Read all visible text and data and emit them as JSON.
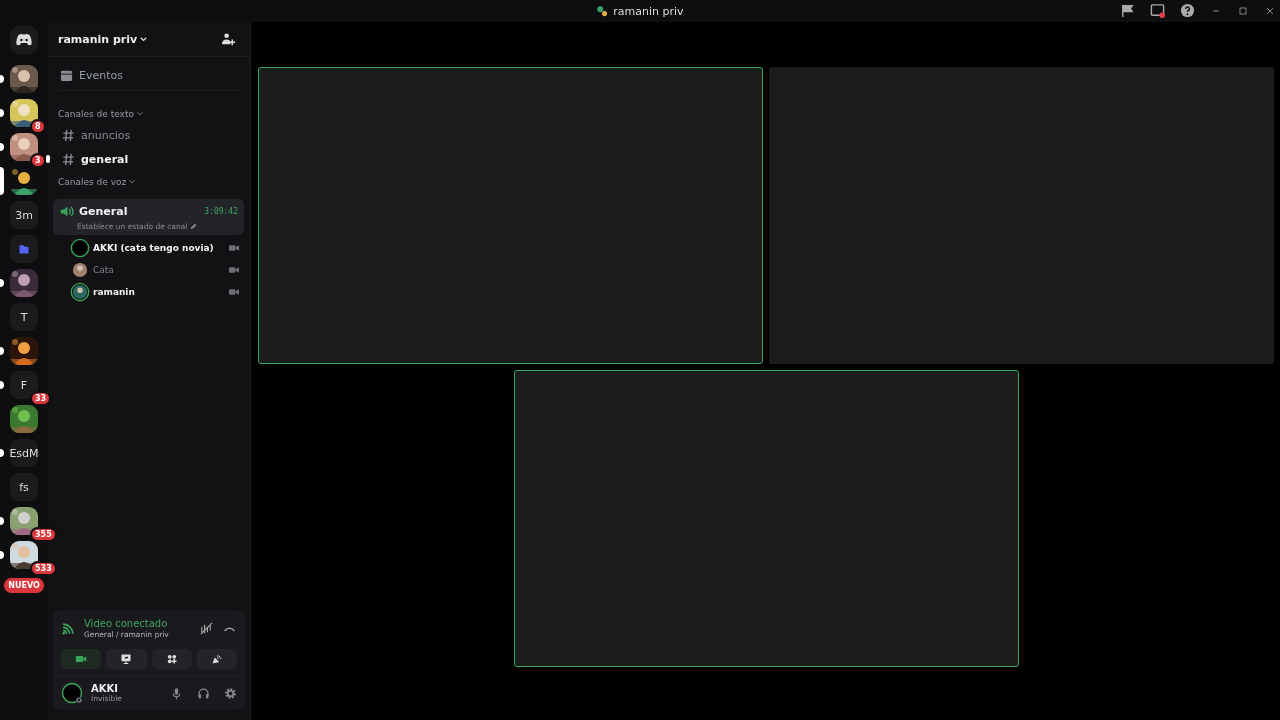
{
  "window": {
    "title": "ramanin priv"
  },
  "servers": [
    {
      "kind": "picture",
      "unread": true,
      "selected": false
    },
    {
      "kind": "picture",
      "unread": true,
      "selected": false,
      "badge": "8"
    },
    {
      "kind": "picture",
      "unread": true,
      "selected": false,
      "badge": "3"
    },
    {
      "kind": "picture",
      "unread": false,
      "selected": true
    },
    {
      "kind": "text",
      "label": "3m",
      "unread": false,
      "selected": false
    },
    {
      "kind": "folder",
      "unread": false,
      "selected": false
    },
    {
      "kind": "picture",
      "unread": true,
      "selected": false
    },
    {
      "kind": "text",
      "label": "T",
      "unread": false,
      "selected": false
    },
    {
      "kind": "picture",
      "unread": true,
      "selected": false
    },
    {
      "kind": "text",
      "label": "F",
      "unread": true,
      "selected": false,
      "badge": "33"
    },
    {
      "kind": "picture",
      "unread": false,
      "selected": false
    },
    {
      "kind": "text",
      "label": "EsdM",
      "unread": true,
      "selected": false
    },
    {
      "kind": "text",
      "label": "fs",
      "unread": false,
      "selected": false
    },
    {
      "kind": "picture",
      "unread": true,
      "selected": false,
      "badge": "355"
    },
    {
      "kind": "picture",
      "unread": true,
      "selected": false,
      "badge": "533"
    }
  ],
  "new_badge": "NUEVO",
  "server_name": "ramanin priv",
  "events_label": "Eventos",
  "categories": [
    {
      "name": "Canales de texto",
      "channels": [
        {
          "kind": "text",
          "name": "anuncios",
          "selected": false,
          "unread": false
        },
        {
          "kind": "text",
          "name": "general",
          "selected": false,
          "unread": true
        }
      ]
    },
    {
      "name": "Canales de voz",
      "channels": [
        {
          "kind": "voice",
          "name": "General",
          "selected": true,
          "timer": "3:09:42",
          "status": "Establece un estado de canal",
          "members": [
            {
              "name": "AKKI (cata tengo novia)",
              "speaking": true,
              "dimmed": false
            },
            {
              "name": "Cata",
              "speaking": false,
              "dimmed": true
            },
            {
              "name": "ramanin",
              "speaking": true,
              "dimmed": false
            }
          ]
        }
      ]
    }
  ],
  "voice_panel": {
    "status": "Video conectado",
    "location": "General / ramanin priv",
    "actions": [
      {
        "kind": "camera",
        "on": true
      },
      {
        "kind": "screen",
        "on": false
      },
      {
        "kind": "activities",
        "on": false
      },
      {
        "kind": "soundboard",
        "on": false
      }
    ]
  },
  "user": {
    "name": "AKKI",
    "status": "Invisible"
  },
  "tiles": [
    {
      "speaking": true
    },
    {
      "speaking": false
    },
    {
      "speaking": true
    }
  ]
}
